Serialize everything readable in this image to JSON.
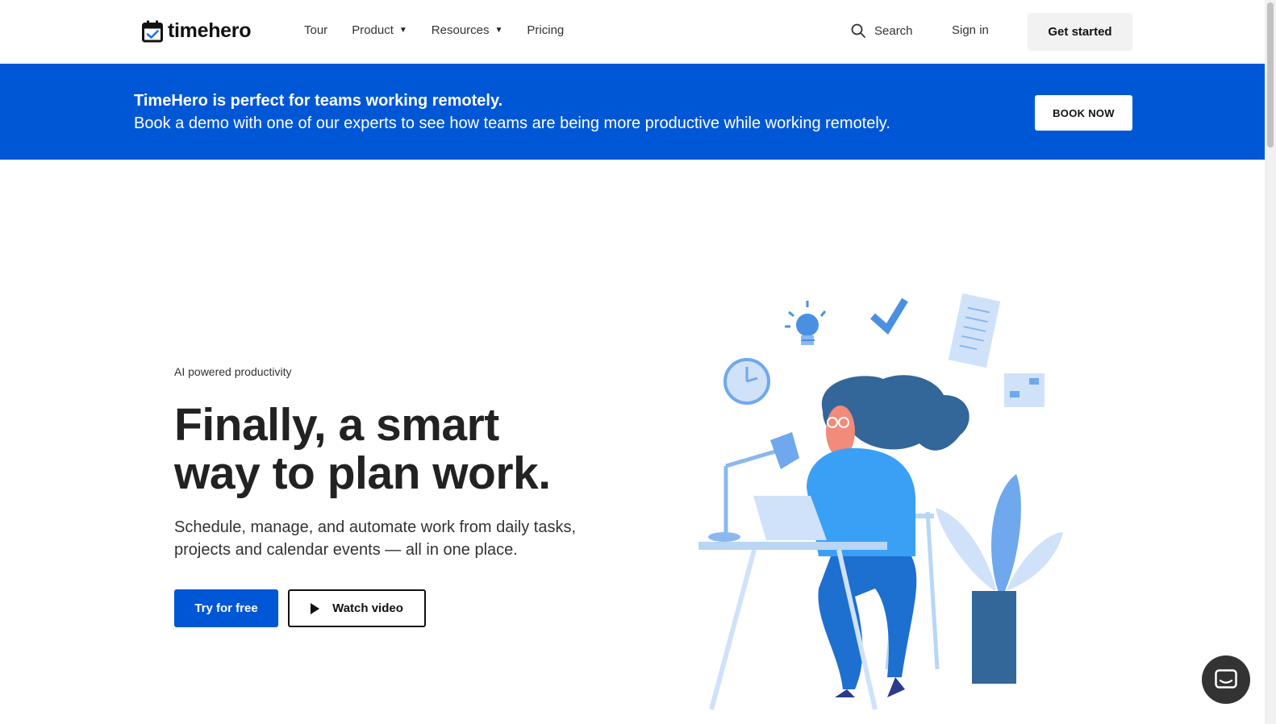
{
  "header": {
    "logo_text": "timehero",
    "nav": [
      {
        "label": "Tour",
        "dropdown": false
      },
      {
        "label": "Product",
        "dropdown": true
      },
      {
        "label": "Resources",
        "dropdown": true
      },
      {
        "label": "Pricing",
        "dropdown": false
      }
    ],
    "search_label": "Search",
    "signin_label": "Sign in",
    "get_started_label": "Get started"
  },
  "banner": {
    "title": "TimeHero is perfect for teams working remotely.",
    "subtitle": "Book a demo with one of our experts to see how teams are being more productive while working remotely.",
    "button_label": "BOOK NOW",
    "background_color": "#0057d5"
  },
  "hero": {
    "eyebrow": "AI powered productivity",
    "headline_line1": "Finally, a smart",
    "headline_line2": "way to plan work.",
    "subtext": "Schedule, manage, and automate work from daily tasks, projects and calendar events — all in one place.",
    "primary_cta": "Try for free",
    "secondary_cta": "Watch video"
  },
  "icons": {
    "logo": "calendar-check-icon",
    "search": "search-icon",
    "play": "play-icon",
    "chat": "chat-icon"
  },
  "colors": {
    "accent": "#0057d5",
    "text_dark": "#222222"
  }
}
